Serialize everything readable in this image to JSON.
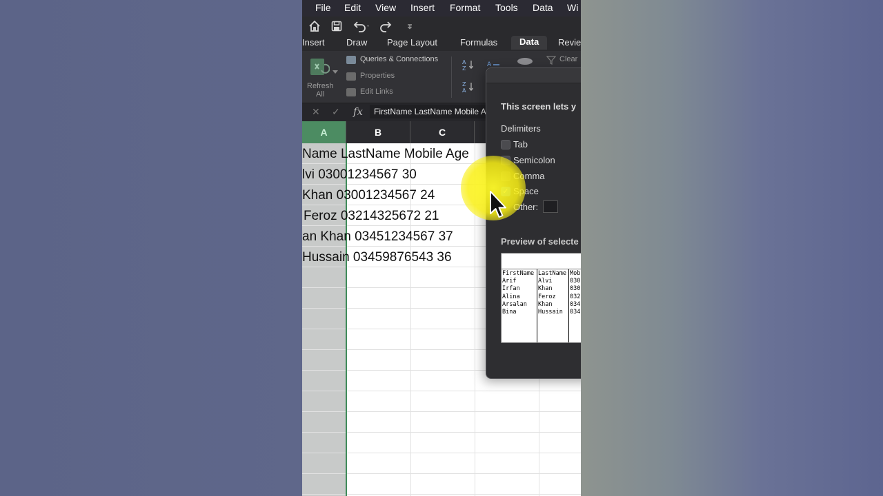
{
  "menubar": {
    "items": [
      "File",
      "Edit",
      "View",
      "Insert",
      "Format",
      "Tools",
      "Data",
      "Wi"
    ]
  },
  "toolbar": {
    "icons": [
      "home-icon",
      "save-icon",
      "undo-icon",
      "redo-icon",
      "customize-icon"
    ]
  },
  "ribbon_tabs": [
    "Insert",
    "Draw",
    "Page Layout",
    "Formulas",
    "Data",
    "Revie"
  ],
  "active_tab": "Data",
  "ribbon": {
    "refresh_label_1": "Refresh",
    "refresh_label_2": "All",
    "queries": "Queries & Connections",
    "properties": "Properties",
    "edit_links": "Edit Links",
    "clear": "Clear"
  },
  "formula_bar": {
    "fx": "fx",
    "content": "FirstName LastName Mobile Age"
  },
  "columns": [
    "A",
    "B",
    "C"
  ],
  "rows": [
    "Name LastName Mobile Age",
    "lvi 03001234567 30",
    "Khan 03001234567 24",
    "Feroz 03214325672 21",
    "an Khan 03451234567 37",
    "Hussain 03459876543 36"
  ],
  "dialog": {
    "intro": "This screen lets y",
    "delimiters_heading": "Delimiters",
    "options": [
      {
        "label": "Tab",
        "checked": false
      },
      {
        "label": "Semicolon",
        "checked": false
      },
      {
        "label": "Comma",
        "checked": false
      },
      {
        "label": "Space",
        "checked": true
      }
    ],
    "other_label": "Other:",
    "preview_heading": "Preview of selecte",
    "preview_columns": [
      [
        "FirstName",
        "Arif",
        "Irfan",
        "Alina",
        "Arsalan",
        "Bina"
      ],
      [
        "LastName",
        "Alvi",
        "Khan",
        "Feroz",
        "Khan",
        "Hussain"
      ],
      [
        "Mobi",
        "030",
        "030",
        "032",
        "034",
        "034"
      ]
    ]
  },
  "colors": {
    "selected_column": "#4c8c62",
    "highlight": "#fff528",
    "checkbox_on": "#2f7de1"
  }
}
